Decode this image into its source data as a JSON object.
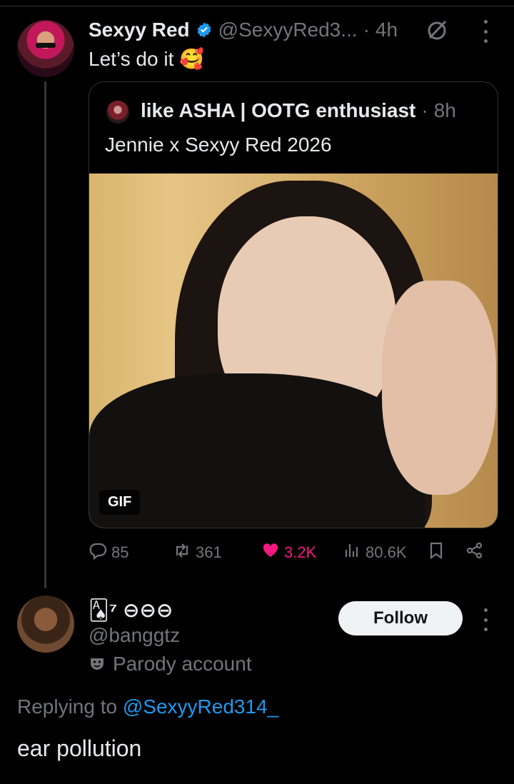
{
  "main_post": {
    "display_name": "Sexyy Red",
    "handle": "@SexyyRed3...",
    "separator": "·",
    "time": "4h",
    "text": "Let’s do it 🥰"
  },
  "quote": {
    "display_name": "like ASHA | OOTG enthusiast",
    "separator": "·",
    "time": "8h",
    "text": "Jennie x Sexyy Red 2026",
    "media_badge": "GIF"
  },
  "actions": {
    "replies": "85",
    "reposts": "361",
    "likes": "3.2K",
    "views": "80.6K",
    "like_color": "#f91880"
  },
  "reply_author": {
    "display_name": "🂡⁷ ⊖⊖⊖",
    "handle": "@banggtz",
    "label": "Parody account",
    "follow_label": "Follow"
  },
  "reply": {
    "replying_prefix": "Replying to",
    "replying_handle": "@SexyyRed314_",
    "text": "ear pollution"
  },
  "colors": {
    "background": "#000000",
    "accent": "#1d9bf0",
    "verified": "#1d9bf0"
  }
}
